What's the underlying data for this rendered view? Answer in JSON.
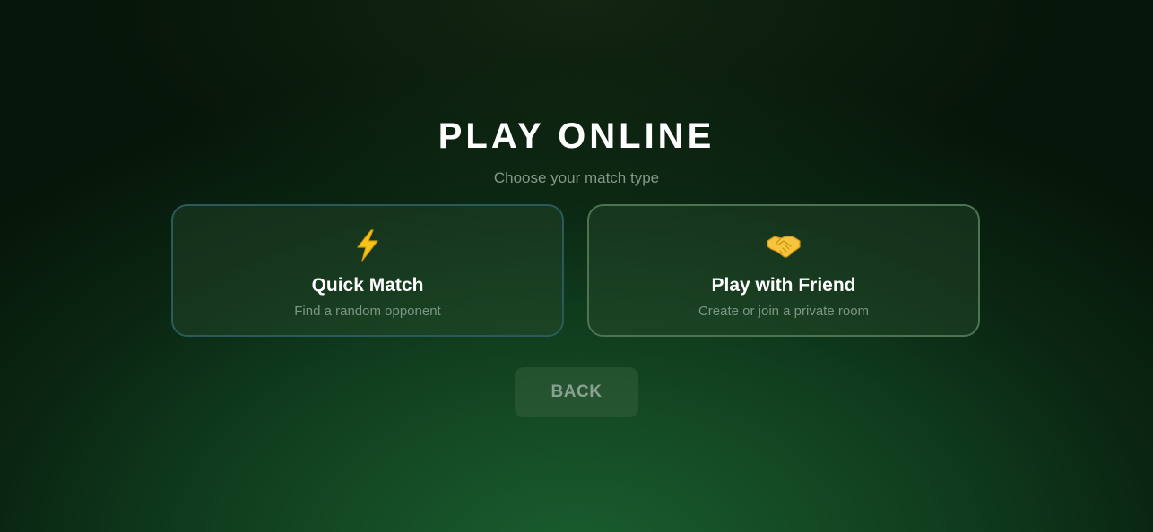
{
  "header": {
    "title": "PLAY ONLINE",
    "subtitle": "Choose your match type"
  },
  "options": [
    {
      "icon": "lightning-icon",
      "label": "Quick Match",
      "description": "Find a random opponent",
      "border_color": "#2b5a5c"
    },
    {
      "icon": "handshake-icon",
      "label": "Play with Friend",
      "description": "Create or join a private room",
      "border_color": "#4d7352"
    }
  ],
  "back_button": {
    "label": "BACK"
  },
  "colors": {
    "background": "#0f3a1c",
    "accent_glow": "#1a5e2e",
    "text_primary": "#ffffff",
    "text_muted": "#7f9a86"
  }
}
